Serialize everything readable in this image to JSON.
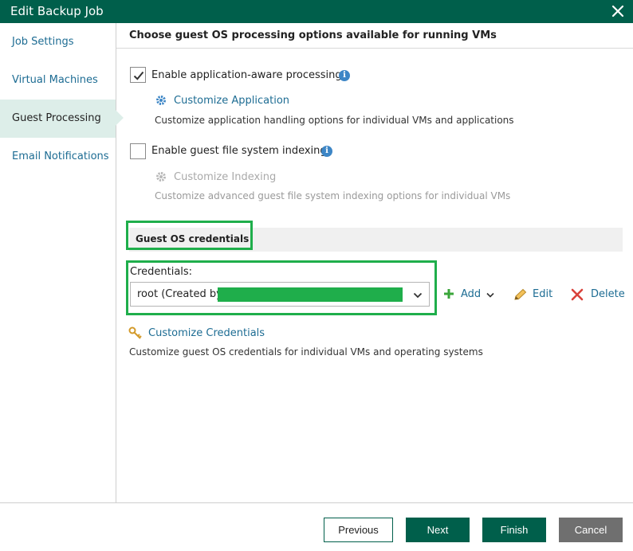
{
  "window": {
    "title": "Edit Backup Job",
    "close_icon": "close-icon"
  },
  "sidebar": {
    "items": [
      {
        "label": "Job Settings"
      },
      {
        "label": "Virtual Machines"
      },
      {
        "label": "Guest Processing",
        "active": true
      },
      {
        "label": "Email Notifications"
      }
    ]
  },
  "main": {
    "heading": "Choose guest OS processing options available for running VMs",
    "app_aware": {
      "label": "Enable application-aware processing",
      "checked": true,
      "link": "Customize Application",
      "description": "Customize application handling options for individual VMs and applications"
    },
    "indexing": {
      "label": "Enable guest file system indexing",
      "checked": false,
      "link": "Customize Indexing",
      "description": "Customize advanced guest file system indexing options for individual VMs"
    },
    "credentials_section": {
      "title": "Guest OS credentials",
      "field_label": "Credentials:",
      "selected_value": "root (Created by",
      "add_label": "Add",
      "edit_label": "Edit",
      "delete_label": "Delete",
      "link": "Customize Credentials",
      "description": "Customize guest OS credentials for individual VMs and operating systems"
    }
  },
  "footer": {
    "previous_label": "Previous",
    "next_label": "Next",
    "finish_label": "Finish",
    "cancel_label": "Cancel"
  },
  "colors": {
    "brand": "#005f4b",
    "link": "#1d6c93",
    "highlight": "#1fae4b",
    "active_nav": "#ddeee9"
  }
}
